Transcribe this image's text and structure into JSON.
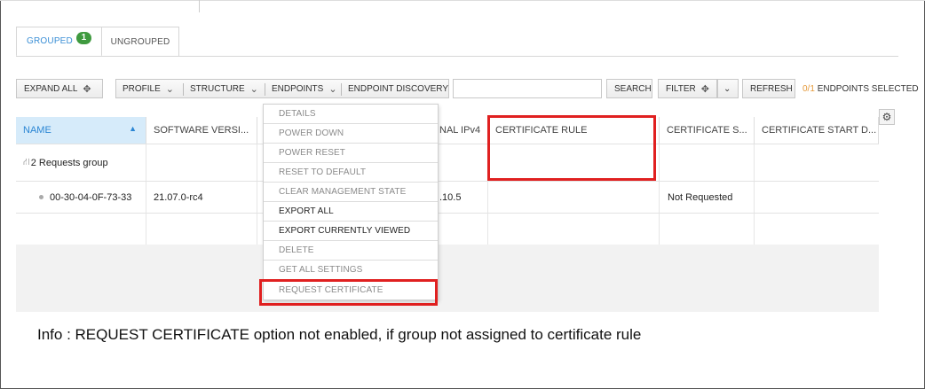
{
  "tabs": [
    {
      "label": "GROUPED",
      "badge": "1"
    },
    {
      "label": "UNGROUPED"
    }
  ],
  "toolbar": {
    "expand_all": "EXPAND ALL",
    "profile": "PROFILE",
    "structure": "STRUCTURE",
    "endpoints": "ENDPOINTS",
    "endpoint_discovery": "ENDPOINT DISCOVERY",
    "search_value": "",
    "search_button": "SEARCH",
    "filter": "FILTER",
    "refresh": "REFRESH",
    "selected_count": "0/1",
    "selected_label": "ENDPOINTS SELECTED"
  },
  "columns": [
    "NAME",
    "SOFTWARE VERSI...",
    "NAL IPv4",
    "CERTIFICATE RULE",
    "CERTIFICATE S...",
    "CERTIFICATE START D..."
  ],
  "rows": [
    {
      "name": "2 Requests group"
    },
    {
      "name": "00-30-04-0F-73-33",
      "software": "21.07.0-rc4",
      "ipv4": ".10.5",
      "cert_status": "Not Requested"
    }
  ],
  "endpoints_menu": [
    {
      "label": "DETAILS",
      "enabled": false
    },
    {
      "label": "POWER DOWN",
      "enabled": false
    },
    {
      "label": "POWER RESET",
      "enabled": false
    },
    {
      "label": "RESET TO DEFAULT",
      "enabled": false
    },
    {
      "label": "CLEAR MANAGEMENT STATE",
      "enabled": false
    },
    {
      "label": "EXPORT ALL",
      "enabled": true
    },
    {
      "label": "EXPORT CURRENTLY VIEWED",
      "enabled": true
    },
    {
      "label": "DELETE",
      "enabled": false
    },
    {
      "label": "GET ALL SETTINGS",
      "enabled": false
    },
    {
      "label": "REQUEST CERTIFICATE",
      "enabled": false
    }
  ],
  "info_text": "Info : REQUEST CERTIFICATE option not enabled, if group not assigned to certificate rule",
  "colors": {
    "accent": "#3b8fd6",
    "highlight": "#e02020",
    "badge": "#3f9a3f",
    "selected_count": "#e59a3b"
  },
  "icons": {
    "expand": "move-arrows-icon",
    "dropdown": "chevron-down-icon",
    "settings": "gear-icon",
    "sort": "sort-ascending-icon",
    "group": "group-icon"
  }
}
